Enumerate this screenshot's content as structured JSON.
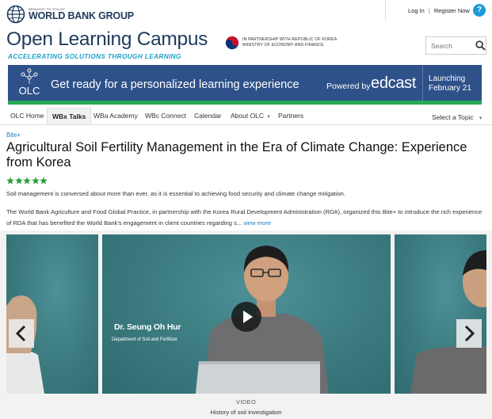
{
  "header": {
    "brand_small": "BROUGHT TO YOU BY",
    "brand_name": "WORLD BANK GROUP",
    "login": "Log In",
    "separator": "|",
    "register": "Register Now",
    "help": "?",
    "site_title": "Open Learning Campus",
    "tagline": "ACCELERATING SOLUTIONS THROUGH LEARNING",
    "partner_line1": "IN PARTNERSHIP WITH REPUBLIC OF KOREA",
    "partner_line2": "MINISTRY OF ECONOMY AND FINANCE",
    "search_placeholder": "Search"
  },
  "banner": {
    "logo_text": "OLC",
    "headline": "Get ready for a personalized learning experience",
    "powered_by": "Powered by",
    "partner_brand": "edcast",
    "launch_line1": "Launching",
    "launch_line2": "February 21"
  },
  "nav": {
    "items": [
      {
        "label": "OLC Home",
        "active": false
      },
      {
        "label": "WBx Talks",
        "active": true
      },
      {
        "label": "WBa Academy",
        "active": false
      },
      {
        "label": "WBc Connect",
        "active": false
      },
      {
        "label": "Calendar",
        "active": false
      },
      {
        "label": "About OLC",
        "active": false,
        "dropdown": true
      },
      {
        "label": "Partners",
        "active": false
      }
    ],
    "topic_select": "Select a Topic"
  },
  "article": {
    "category": "Bite+",
    "title": "Agricultural Soil Fertility Management in the Era of Climate Change: Experience from Korea",
    "rating": 5,
    "summary": "Soil management is conversed about more than ever, as it is essential to achieving food security and climate change mitigation.",
    "description": "The World Bank Agriculture and Food Global Practice, in partnership with the Korea Rural Development Administration (RDA), organized this Bite+ to introduce the rich experience of RDA that has benefited the World Bank's engagement in client countries regarding s...",
    "view_more": "view more"
  },
  "carousel": {
    "speaker_name": "Dr. Seung Oh Hur",
    "speaker_dept": "Department of Soil and Fertilizer",
    "slide_type": "VIDEO",
    "caption": "History of soil investigation"
  },
  "colors": {
    "brand_navy": "#1f3b5c",
    "tagline_blue": "#1aa0c9",
    "banner_blue": "#2e5189",
    "banner_green": "#2aa85a",
    "link_blue": "#1a7bbf",
    "star_green": "#2b9e3a",
    "video_teal": "#3d7d82"
  }
}
